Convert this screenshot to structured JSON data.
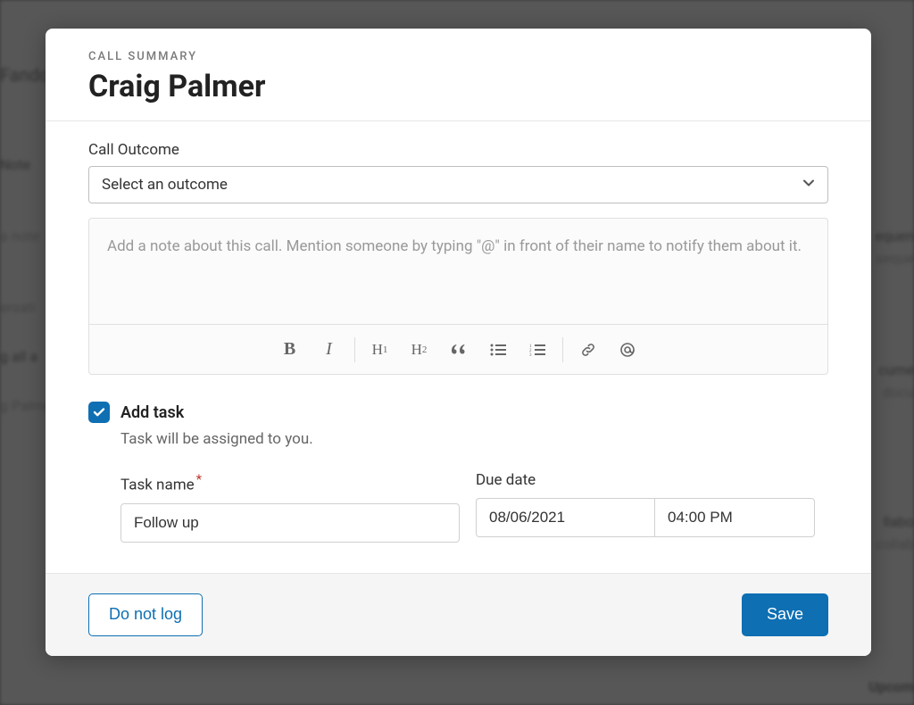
{
  "modal": {
    "eyebrow": "CALL SUMMARY",
    "title": "Craig Palmer",
    "outcome_label": "Call Outcome",
    "outcome_selected": "Select an outcome",
    "note_placeholder": "Add a note about this call. Mention someone by typing \"@\" in front of their name to notify them about it.",
    "add_task_label": "Add task",
    "add_task_checked": true,
    "helper_text": "Task will be assigned to you.",
    "task_name_label": "Task name",
    "task_name_value": "Follow up",
    "due_date_label": "Due date",
    "due_date_value": "08/06/2021",
    "due_time_value": "04:00 PM"
  },
  "footer": {
    "do_not_log": "Do not log",
    "save": "Save"
  },
  "toolbar": {
    "bold": "B",
    "italic": "I",
    "h1_main": "H",
    "h1_sub": "1",
    "h2_main": "H",
    "h2_sub": "2"
  },
  "background": {
    "fando": "Fando",
    "note": "Note",
    "a_note": "a note",
    "ersati": "ersati",
    "all_a": "g all a",
    "palmer": "g Palme",
    "equen": "equen",
    "seque": "seque",
    "cume": "cume",
    "docu": "docu",
    "llabo": "llabo",
    "collab": "collab",
    "upcom": "Upcom"
  }
}
